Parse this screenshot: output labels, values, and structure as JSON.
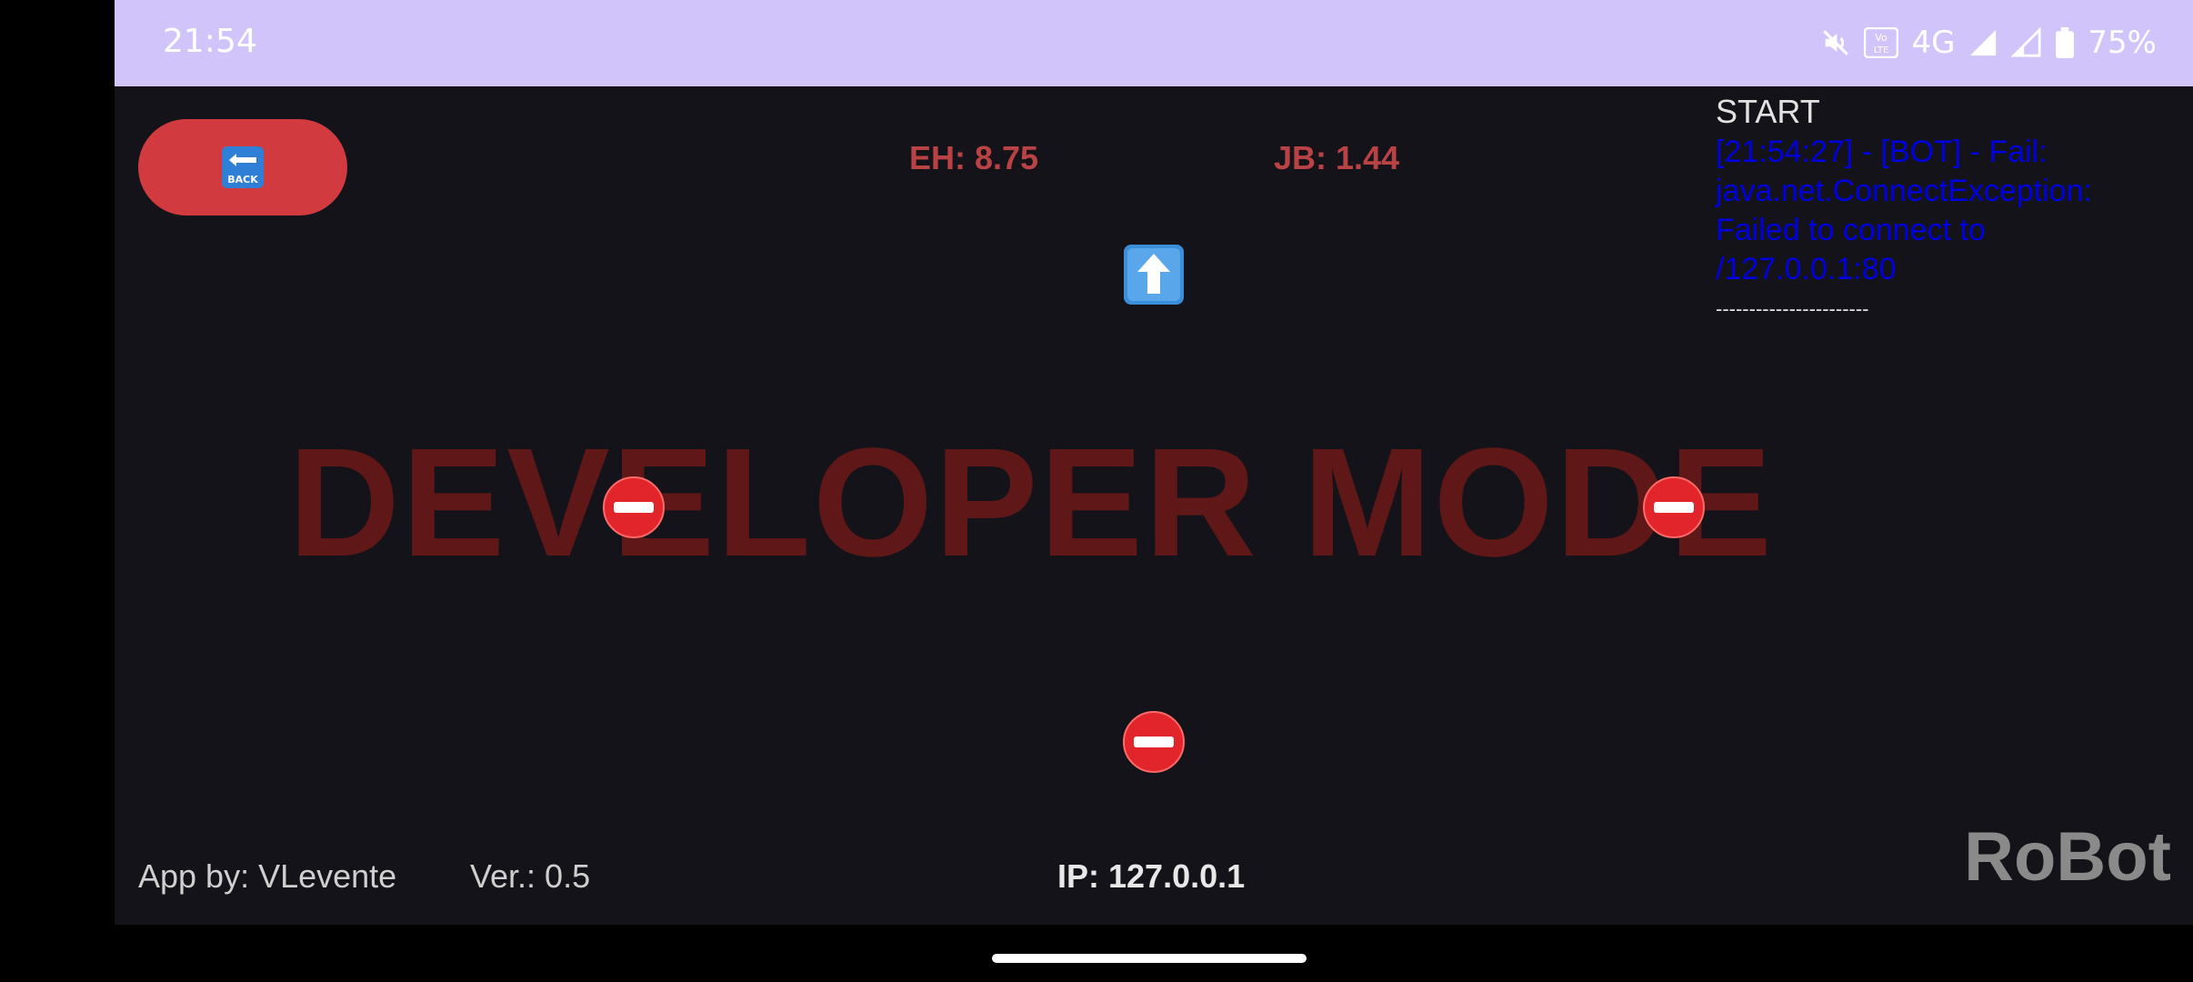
{
  "status_bar": {
    "time": "21:54",
    "network": "4G",
    "battery": "75%",
    "volte_text": "Vo LTE"
  },
  "app": {
    "back_button_icon": "back-arrow-icon",
    "back_button_label": "BACK",
    "eh_label": "EH: 8.75",
    "jb_label": "JB: 1.44",
    "watermark": "DEVELOPER MODE",
    "log": {
      "title": "START",
      "entry": "[21:54:27] - [BOT] - Fail: java.net.ConnectException: Failed to connect to /127.0.0.1:80",
      "separator": "-----------------------"
    },
    "footer": {
      "author": "App by: VLevente",
      "version": "Ver.: 0.5",
      "ip": "IP: 127.0.0.1",
      "brand": "RoBot"
    }
  },
  "colors": {
    "status_bar_bg": "#d1c4fb",
    "app_bg": "#141319",
    "accent_red": "#d13b40",
    "metric_red": "#b94244",
    "watermark_red": "#601717",
    "log_blue": "#0000e0",
    "brand_gray": "#8a8a8a"
  }
}
